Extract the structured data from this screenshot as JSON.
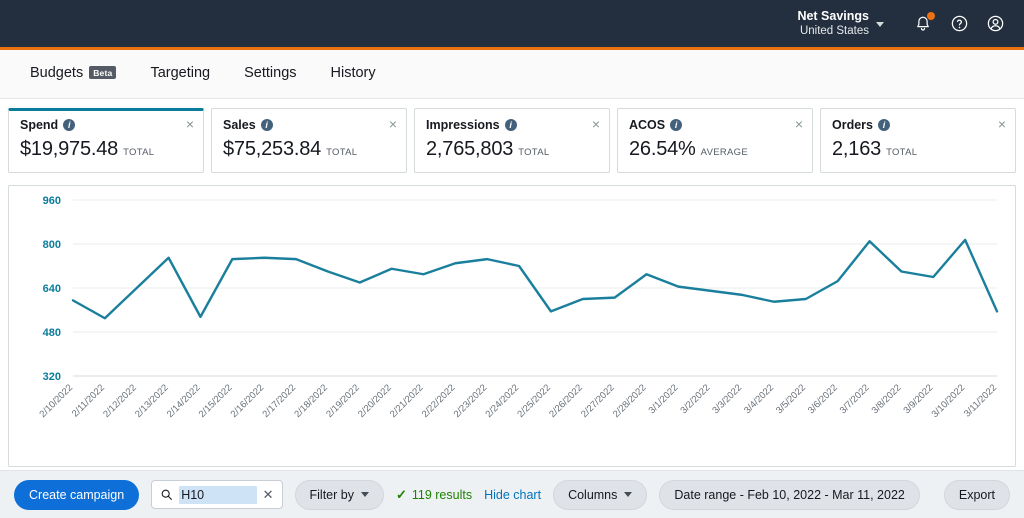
{
  "header": {
    "account_name": "Net Savings",
    "account_country": "United States",
    "chevron_icon": "chevron-down-icon",
    "notifications_icon": "bell-icon",
    "help_icon": "question-circle-icon",
    "profile_icon": "user-circle-icon",
    "accent_color": "#ec7211",
    "background_color": "#232f3e"
  },
  "nav": {
    "items": [
      {
        "label": "Budgets",
        "badge": "Beta"
      },
      {
        "label": "Targeting",
        "badge": ""
      },
      {
        "label": "Settings",
        "badge": ""
      },
      {
        "label": "History",
        "badge": ""
      }
    ]
  },
  "metric_cards": [
    {
      "title": "Spend",
      "value": "$19,975.48",
      "unit": "TOTAL",
      "selected": true,
      "close": "×"
    },
    {
      "title": "Sales",
      "value": "$75,253.84",
      "unit": "TOTAL",
      "selected": false,
      "close": "×"
    },
    {
      "title": "Impressions",
      "value": "2,765,803",
      "unit": "TOTAL",
      "selected": false,
      "close": "×"
    },
    {
      "title": "ACOS",
      "value": "26.54%",
      "unit": "AVERAGE",
      "selected": false,
      "close": "×"
    },
    {
      "title": "Orders",
      "value": "2,163",
      "unit": "TOTAL",
      "selected": false,
      "close": "×"
    }
  ],
  "chart_data": {
    "type": "line",
    "title": "",
    "xlabel": "",
    "ylabel": "",
    "ylim": [
      320,
      960
    ],
    "yticks": [
      320,
      480,
      640,
      800,
      960
    ],
    "grid": true,
    "legend": false,
    "line_color": "#1a7f9c",
    "series_name": "Spend",
    "categories": [
      "2/10/2022",
      "2/11/2022",
      "2/12/2022",
      "2/13/2022",
      "2/14/2022",
      "2/15/2022",
      "2/16/2022",
      "2/17/2022",
      "2/18/2022",
      "2/19/2022",
      "2/20/2022",
      "2/21/2022",
      "2/22/2022",
      "2/23/2022",
      "2/24/2022",
      "2/25/2022",
      "2/26/2022",
      "2/27/2022",
      "2/28/2022",
      "3/1/2022",
      "3/2/2022",
      "3/3/2022",
      "3/4/2022",
      "3/5/2022",
      "3/6/2022",
      "3/7/2022",
      "3/8/2022",
      "3/9/2022",
      "3/10/2022",
      "3/11/2022"
    ],
    "values": [
      595,
      530,
      640,
      750,
      535,
      745,
      750,
      745,
      700,
      660,
      710,
      690,
      730,
      745,
      720,
      555,
      600,
      605,
      690,
      645,
      630,
      615,
      590,
      600,
      665,
      810,
      700,
      680,
      815,
      555
    ]
  },
  "toolbar": {
    "create_campaign_label": "Create campaign",
    "search_icon": "search-icon",
    "search_value": "H10",
    "search_clear_icon": "close-icon",
    "filter_by_label": "Filter by",
    "results_check_icon": "check-icon",
    "results_label": "119 results",
    "hide_chart_label": "Hide chart",
    "columns_label": "Columns",
    "date_range_label": "Date range - Feb 10, 2022 - Mar 11, 2022",
    "export_label": "Export"
  }
}
